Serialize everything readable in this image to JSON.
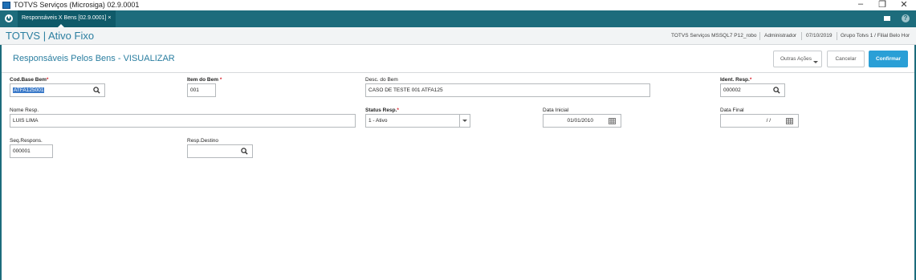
{
  "window": {
    "title": "TOTVS Serviços (Microsiga) 02.9.0001",
    "minimize": "–",
    "restore": "❐",
    "close": "✕"
  },
  "tabbar": {
    "tab_label": "Responsáveis X Bens [02.9.0001] ×"
  },
  "header": {
    "app_title": "TOTVS | Ativo Fixo",
    "environment": "TOTVS Serviços MSSQL7 P12_robo",
    "user": "Administrador",
    "date": "07/10/2019",
    "company": "Grupo Totvs 1 / Filial Belo Hor"
  },
  "page": {
    "title": "Responsáveis Pelos Bens - VISUALIZAR",
    "actions": {
      "more_label": "Outras Ações",
      "cancel_label": "Cancelar",
      "confirm_label": "Confirmar"
    }
  },
  "form": {
    "cod_base_bem": {
      "label": "Cod.Base Bem",
      "required": "*",
      "value": "ATFA125001"
    },
    "item_do_bem": {
      "label": "Item do Bem",
      "required": "*",
      "value": "001"
    },
    "desc_do_bem": {
      "label": "Desc. do Bem",
      "value": "CASO DE TESTE 001 ATFA125"
    },
    "ident_resp": {
      "label": "Ident. Resp.",
      "required": "*",
      "value": "000002"
    },
    "nome_resp": {
      "label": "Nome Resp.",
      "value": "LUIS LIMA"
    },
    "status_resp": {
      "label": "Status Resp.",
      "required": "*",
      "value": "1 - Ativo"
    },
    "data_inicial": {
      "label": "Data Inicial",
      "value": "01/01/2010"
    },
    "data_final": {
      "label": "Data Final",
      "value": "/ /"
    },
    "seq_respons": {
      "label": "Seq.Respons.",
      "value": "000001"
    },
    "resp_destino": {
      "label": "Resp.Destino",
      "value": ""
    }
  },
  "icons": {
    "app": "app-icon",
    "home": "home-icon",
    "mail": "mail-icon",
    "help": "help-icon",
    "search": "search-icon",
    "calendar": "calendar-icon"
  },
  "colors": {
    "tabbar": "#1d6c7c",
    "title_text": "#2a7ea0",
    "primary_button": "#2a9fd6",
    "required_marker": "#d9232d",
    "selection": "#3b7ac9"
  }
}
